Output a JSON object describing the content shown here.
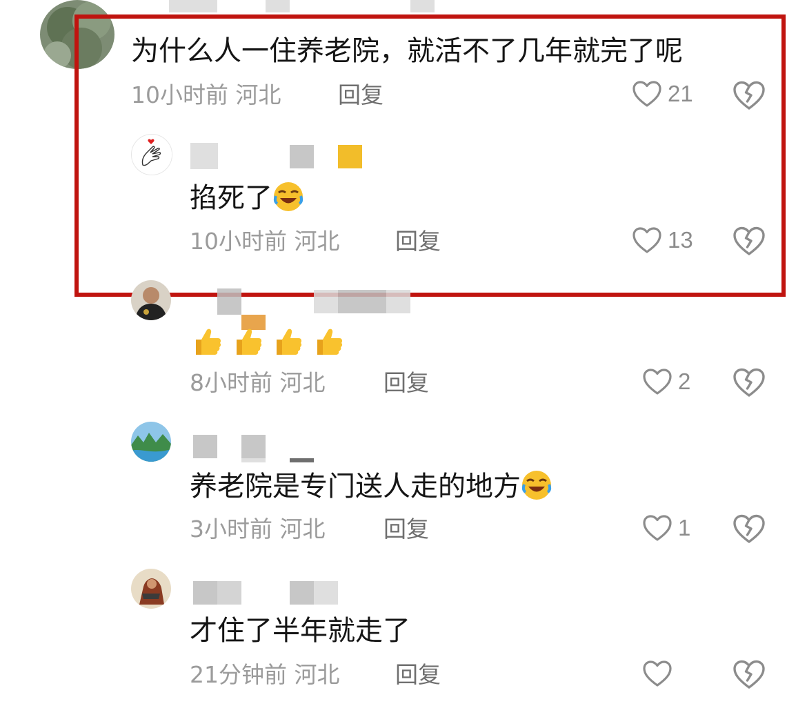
{
  "main_comment": {
    "text": "为什么人一住养老院，就活不了几年就完了呢",
    "time": "10小时前",
    "location": "河北",
    "reply_label": "回复",
    "likes": "21"
  },
  "replies": [
    {
      "text": "掐死了",
      "emoji": "laughing-crying-emoji",
      "time": "10小时前",
      "location": "河北",
      "reply_label": "回复",
      "likes": "13"
    },
    {
      "text": "",
      "emoji": "thumbs-up-emoji x4",
      "time": "8小时前",
      "location": "河北",
      "reply_label": "回复",
      "likes": "2"
    },
    {
      "text": "养老院是专门送人走的地方",
      "emoji": "laughing-crying-emoji",
      "time": "3小时前",
      "location": "河北",
      "reply_label": "回复",
      "likes": "1"
    },
    {
      "text": "才住了半年就走了",
      "time": "21分钟前",
      "location": "河北",
      "reply_label": "回复",
      "likes": ""
    }
  ],
  "icons": {
    "like": "heart-outline-icon",
    "dislike": "broken-heart-icon"
  },
  "colors": {
    "highlight_border": "#c0140f",
    "meta_text": "#9b9b9b",
    "reply_text": "#6f6f6f",
    "icon": "#8c8c8c"
  }
}
